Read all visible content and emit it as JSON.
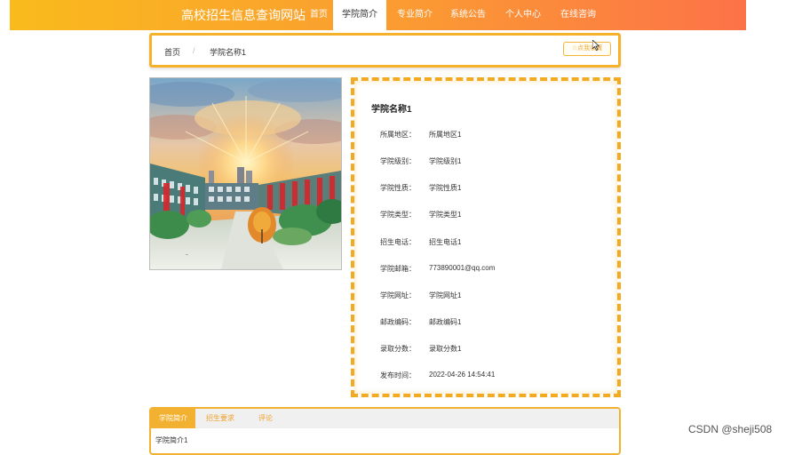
{
  "header": {
    "site_title": "高校招生信息查询网站",
    "nav": [
      {
        "label": "首页",
        "active": false
      },
      {
        "label": "学院简介",
        "active": true
      },
      {
        "label": "专业简介",
        "active": false
      },
      {
        "label": "系统公告",
        "active": false
      },
      {
        "label": "个人中心",
        "active": false
      },
      {
        "label": "在线咨询",
        "active": false
      }
    ]
  },
  "breadcrumb": {
    "home": "首页",
    "separator": "/",
    "current": "学院名称1",
    "collect_button": "点我收藏",
    "collect_icon": "star-outline-icon"
  },
  "college": {
    "photo": "watercolor-campus-illustration",
    "name": "学院名称1",
    "fields": [
      {
        "label": "所属地区：",
        "value": "所属地区1"
      },
      {
        "label": "学院级别：",
        "value": "学院级别1"
      },
      {
        "label": "学院性质：",
        "value": "学院性质1"
      },
      {
        "label": "学院类型：",
        "value": "学院类型1"
      },
      {
        "label": "招生电话：",
        "value": "招生电话1"
      },
      {
        "label": "学院邮箱：",
        "value": "773890001@qq.com"
      },
      {
        "label": "学院网址：",
        "value": "学院网址1"
      },
      {
        "label": "邮政编码：",
        "value": "邮政编码1"
      },
      {
        "label": "录取分数：",
        "value": "录取分数1"
      },
      {
        "label": "发布时间：",
        "value": "2022-04-26 14:54:41"
      }
    ]
  },
  "tabs": {
    "items": [
      {
        "label": "学院简介",
        "active": true
      },
      {
        "label": "招生要求",
        "active": false
      },
      {
        "label": "评论",
        "active": false
      }
    ],
    "content": "学院简介1"
  },
  "watermark": "CSDN @sheji508",
  "colors": {
    "header_start": "#f9bb1c",
    "header_end": "#fc7248",
    "accent": "#f6b12b",
    "dashed_border": "#f2aa21"
  }
}
